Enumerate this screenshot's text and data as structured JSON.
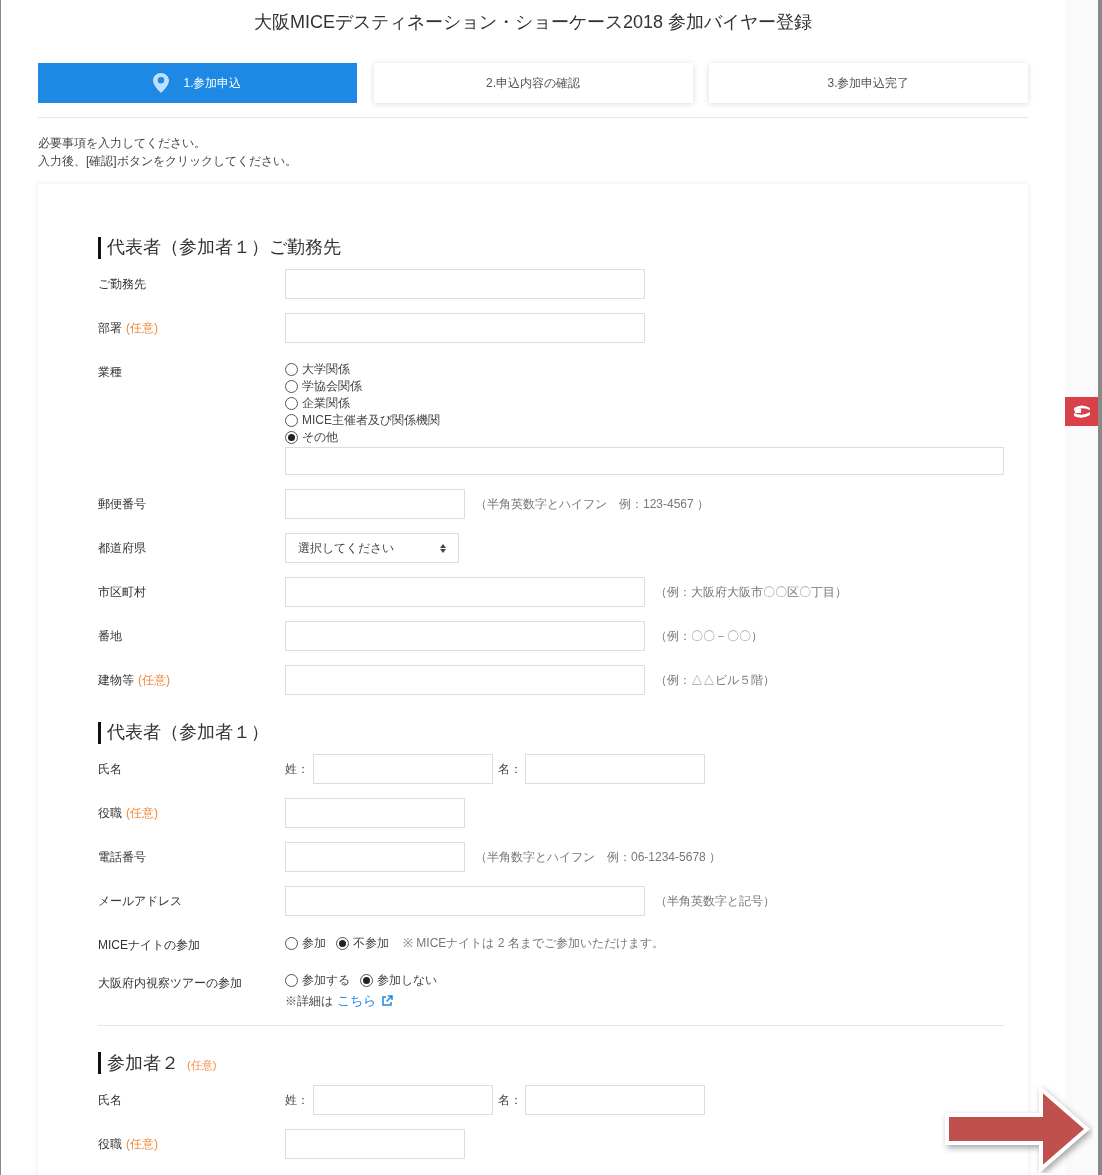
{
  "title": "大阪MICEデスティネーション・ショーケース2018 参加バイヤー登録",
  "steps": [
    {
      "label": "1.参加申込",
      "selected": true
    },
    {
      "label": "2.申込内容の確認",
      "selected": false
    },
    {
      "label": "3.参加申込完了",
      "selected": false
    }
  ],
  "instructions": [
    "必要事項を入力してください。",
    "入力後、[確認]ボタンをクリックしてください。"
  ],
  "sections": [
    {
      "heading": "代表者（参加者１）ご勤務先",
      "divider": false,
      "rows": [
        {
          "kind": "long",
          "label": "ご勤務先"
        },
        {
          "kind": "long",
          "label": "部署",
          "optional": "(任意)"
        },
        {
          "kind": "radio_list",
          "label": "業種",
          "options": [
            {
              "label": "大学関係",
              "selected": false
            },
            {
              "label": "学協会関係",
              "selected": false
            },
            {
              "label": "企業関係",
              "selected": false
            },
            {
              "label": "MICE主催者及び関係機関",
              "selected": false
            },
            {
              "label": "その他",
              "selected": true
            }
          ]
        },
        {
          "kind": "short",
          "label": "郵便番号",
          "hint": "（半角英数字とハイフン　例：123-4567 ）"
        },
        {
          "kind": "select",
          "label": "都道府県",
          "value": "選択してください"
        },
        {
          "kind": "long",
          "label": "市区町村",
          "hint": "（例：大阪府大阪市〇〇区〇丁目）"
        },
        {
          "kind": "long",
          "label": "番地",
          "hint": "（例：〇〇－〇〇）"
        },
        {
          "kind": "long",
          "label": "建物等",
          "optional": "(任意)",
          "hint": "（例：△△ビル５階）"
        }
      ]
    },
    {
      "heading": "代表者（参加者１）",
      "divider": true,
      "rows": [
        {
          "kind": "name",
          "label": "氏名",
          "last": "姓：",
          "first": "名："
        },
        {
          "kind": "short",
          "label": "役職",
          "optional": "(任意)"
        },
        {
          "kind": "short",
          "label": "電話番号",
          "hint": "（半角数字とハイフン　例：06-1234-5678 ）"
        },
        {
          "kind": "long",
          "label": "メールアドレス",
          "hint": "（半角英数字と記号）"
        },
        {
          "kind": "radio_inline",
          "label": "MICEナイトの参加",
          "options": [
            {
              "label": "参加",
              "selected": false
            },
            {
              "label": "不参加",
              "selected": true
            }
          ],
          "note": "※ MICEナイトは 2 名までご参加いただけます。"
        },
        {
          "kind": "radio_inline",
          "label": "大阪府内視察ツアーの参加",
          "options": [
            {
              "label": "参加する",
              "selected": false
            },
            {
              "label": "参加しない",
              "selected": true
            }
          ],
          "detail": "※詳細は",
          "link": "こちら"
        }
      ]
    },
    {
      "heading": "参加者２",
      "optional": "(任意)",
      "divider": false,
      "rows": [
        {
          "kind": "name",
          "label": "氏名",
          "last": "姓：",
          "first": "名："
        },
        {
          "kind": "short",
          "label": "役職",
          "optional": "(任意)"
        }
      ]
    }
  ]
}
